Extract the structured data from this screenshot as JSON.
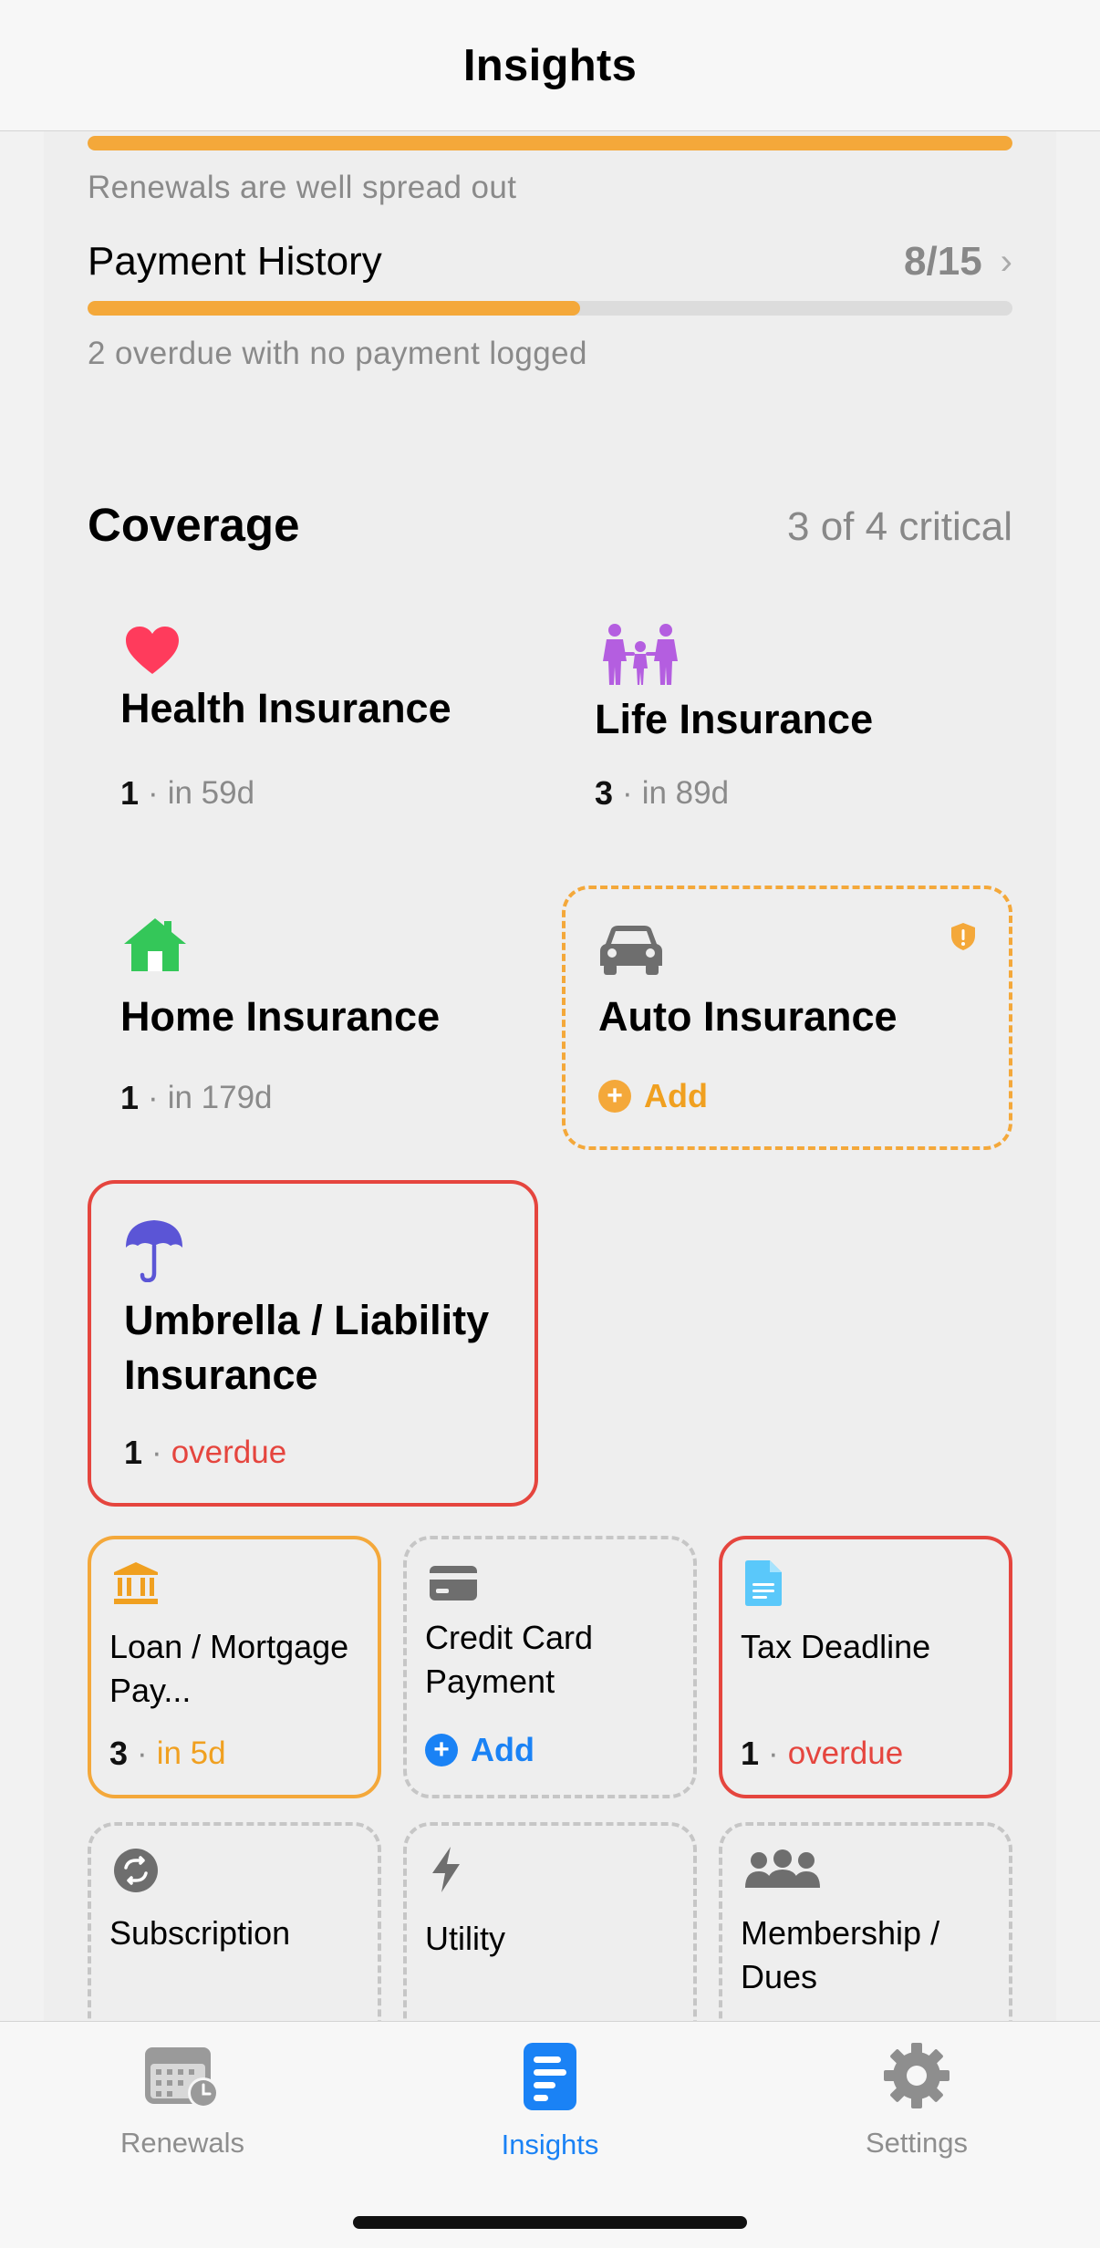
{
  "nav": {
    "title": "Insights"
  },
  "summary": {
    "renewals_note": "Renewals are well spread out",
    "renewals_progress": 1.0,
    "payment_history": {
      "label": "Payment History",
      "score": "8/15",
      "progress": 0.533,
      "note": "2 overdue with no payment logged"
    }
  },
  "coverage": {
    "title": "Coverage",
    "subtitle": "3 of 4 critical",
    "tiles": [
      {
        "name": "Health Insurance",
        "count": "1",
        "sep": "·",
        "status": "in 59d",
        "icon": "heart-icon",
        "color": "#ff3b5c"
      },
      {
        "name": "Life Insurance",
        "count": "3",
        "sep": "·",
        "status": "in 89d",
        "icon": "family-icon",
        "color": "#b45ee0"
      },
      {
        "name": "Home Insurance",
        "count": "1",
        "sep": "·",
        "status": "in 179d",
        "icon": "house-icon",
        "color": "#34c759"
      },
      {
        "name": "Auto Insurance",
        "action": "Add",
        "badge": "!",
        "icon": "car-icon",
        "color": "#6e6e6e"
      },
      {
        "name": "Umbrella / Liability Insurance",
        "count": "1",
        "sep": "·",
        "status": "overdue",
        "icon": "umbrella-icon",
        "color": "#5b55d6"
      },
      {
        "name": "Loan / Mortgage Pay...",
        "count": "3",
        "sep": "·",
        "status": "in 5d",
        "icon": "bank-icon",
        "color": "#f0a020"
      },
      {
        "name": "Credit Card Payment",
        "action": "Add",
        "icon": "credit-card-icon",
        "color": "#6e6e6e"
      },
      {
        "name": "Tax Deadline",
        "count": "1",
        "sep": "·",
        "status": "overdue",
        "icon": "document-icon",
        "color": "#5ac8fa"
      },
      {
        "name": "Subscription",
        "icon": "recurring-icon",
        "color": "#6e6e6e"
      },
      {
        "name": "Utility",
        "icon": "bolt-icon",
        "color": "#6e6e6e"
      },
      {
        "name": "Membership / Dues",
        "icon": "group-icon",
        "color": "#6e6e6e"
      }
    ]
  },
  "tabs": [
    {
      "label": "Renewals",
      "icon": "calendar-clock-icon",
      "active": false
    },
    {
      "label": "Insights",
      "icon": "insights-icon",
      "active": true
    },
    {
      "label": "Settings",
      "icon": "gear-icon",
      "active": false
    }
  ],
  "colors": {
    "accent": "#1a82f5",
    "warning": "#f4a83a",
    "danger": "#e5453e"
  }
}
